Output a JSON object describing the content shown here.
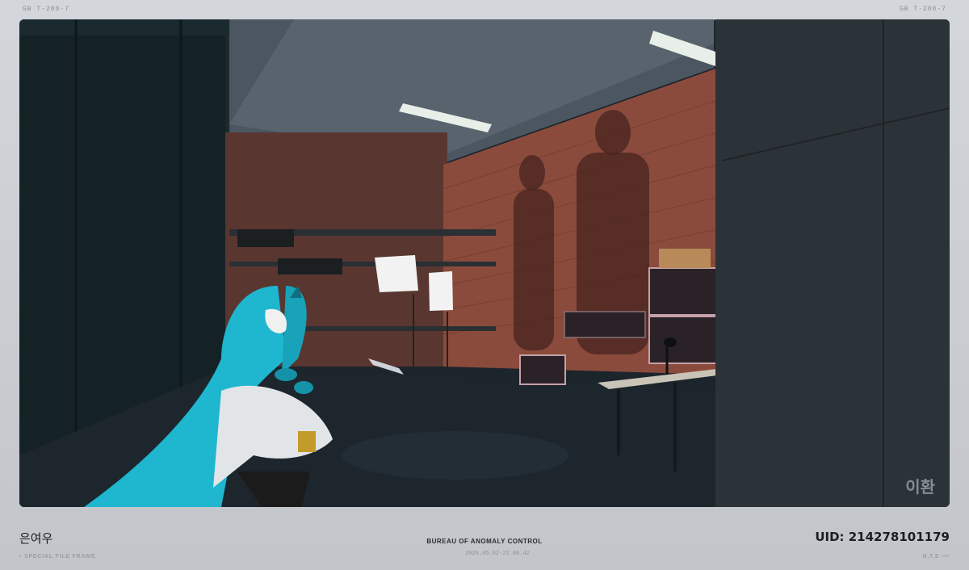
{
  "header": {
    "left_code": "GB  T-200-7",
    "right_code": "GB  T-200-7"
  },
  "scene": {
    "watermark": "이환"
  },
  "footer": {
    "player_name": "은여우",
    "organization": "BUREAU OF ANOMALY CONTROL",
    "timestamp": "2026.05.02-22.06.42",
    "uid": "UID: 214278101179",
    "left_caption": "• SPECIAL FILE FRAME",
    "right_caption": "N.T.E •••"
  },
  "colors": {
    "frame": "#c8cbd0",
    "brick": "#8a4b3c",
    "hair": "#1fb6cf",
    "floor": "#1d262d"
  }
}
